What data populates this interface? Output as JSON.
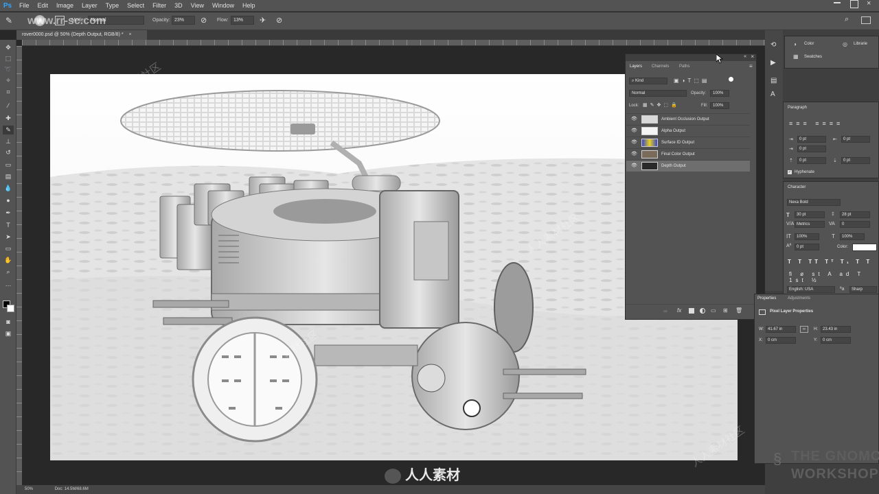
{
  "app": {
    "logo": "Ps"
  },
  "menu": [
    "File",
    "Edit",
    "Image",
    "Layer",
    "Type",
    "Select",
    "Filter",
    "3D",
    "View",
    "Window",
    "Help"
  ],
  "options": {
    "mode_label": "Mode:",
    "mode_value": "Normal",
    "opacity_label": "Opacity:",
    "opacity_value": "23%",
    "flow_label": "Flow:",
    "flow_value": "13%"
  },
  "document": {
    "tab_title": "rover0000.psd @ 50% (Depth Output, RGB/8) *"
  },
  "watermark": {
    "site": "www.rr-sc.com",
    "chinese": "人人素材社区",
    "brand": "人人素材"
  },
  "layers_panel": {
    "tabs": [
      "Layers",
      "Channels",
      "Paths"
    ],
    "filter_kind": "Kind",
    "blend_mode": "Normal",
    "opacity_label": "Opacity:",
    "opacity_value": "100%",
    "lock_label": "Lock:",
    "fill_label": "Fill:",
    "fill_value": "100%",
    "layers": [
      {
        "name": "Ambient Occlusion Output",
        "selected": false,
        "thumb_color": "#d8d8d8"
      },
      {
        "name": "Alpha Output",
        "selected": false,
        "thumb_color": "#f4f4f4"
      },
      {
        "name": "Surface ID Output",
        "selected": false,
        "thumb_color": "#3a46c8"
      },
      {
        "name": "Final Color Output",
        "selected": false,
        "thumb_color": "#7a6a5a"
      },
      {
        "name": "Depth Output",
        "selected": true,
        "thumb_color": "#2a2a2a"
      }
    ],
    "footer_icons": [
      "link-icon",
      "fx-icon",
      "mask-icon",
      "adjustment-icon",
      "folder-icon",
      "new-layer-icon",
      "trash-icon"
    ]
  },
  "color_panel": {
    "color_label": "Color",
    "swatches_label": "Swatches",
    "libraries_label": "Librarie"
  },
  "paragraph_panel": {
    "title": "Paragraph",
    "left_indent": "0 pt",
    "right_indent": "0 pt",
    "first_line": "0 pt",
    "space_before": "0 pt",
    "space_after": "0 pt",
    "hyphenate_label": "Hyphenate"
  },
  "character_panel": {
    "title": "Character",
    "font": "Nexa Bold",
    "size": "30 pt",
    "leading": "28 pt",
    "kerning": "Metrics",
    "tracking": "0",
    "vscale": "100%",
    "hscale": "100%",
    "baseline": "0 pt",
    "color_label": "Color:",
    "language": "English: USA",
    "antialias": "Sharp"
  },
  "properties_panel": {
    "tabs": [
      "Properties",
      "Adjustments"
    ],
    "title": "Pixel Layer Properties",
    "w_label": "W:",
    "w_value": "41.67 in",
    "h_label": "H:",
    "h_value": "23.43 in",
    "x_label": "X:",
    "x_value": "0 cm",
    "y_label": "Y:",
    "y_value": "0 cm"
  },
  "status": {
    "zoom": "50%",
    "doc": "Doc: 14.5M/68.6M"
  },
  "branding": {
    "line1": "THE GNOMON",
    "line2": "WORKSHOP"
  }
}
